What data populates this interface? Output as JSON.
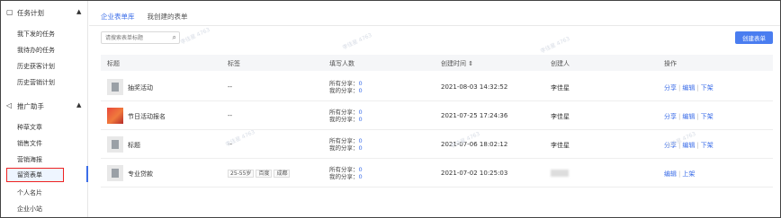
{
  "sidebar": {
    "groups": [
      {
        "label": "任务计划",
        "icon": "task-icon",
        "items": [
          "我下发的任务",
          "我待办的任务",
          "历史获客计划",
          "历史营销计划"
        ]
      },
      {
        "label": "推广助手",
        "icon": "megaphone-icon",
        "items": [
          "种草文章",
          "销售文件",
          "营销海报",
          "留资表单",
          "个人名片",
          "企业小站"
        ]
      }
    ]
  },
  "tabs": [
    "企业表单库",
    "我创建的表单"
  ],
  "search": {
    "placeholder": "请搜索表单标题"
  },
  "create_button": "创建表单",
  "table": {
    "headers": [
      "标题",
      "标签",
      "填写人数",
      "创建时间 ⇕",
      "创建人",
      "操作"
    ],
    "fill_labels": {
      "all": "所有分享：",
      "mine": "我的分享："
    },
    "rows": [
      {
        "title": "抽奖活动",
        "tag": "--",
        "all": "0",
        "mine": "0",
        "time": "2021-08-03 14:32:52",
        "creator": "李佳星",
        "ops": [
          "分享",
          "编辑",
          "下架"
        ],
        "thumb": "doc"
      },
      {
        "title": "节日活动报名",
        "tag": "--",
        "all": "0",
        "mine": "0",
        "time": "2021-07-25 17:24:36",
        "creator": "李佳星",
        "ops": [
          "分享",
          "编辑",
          "下架"
        ],
        "thumb": "img"
      },
      {
        "title": "标题",
        "tag": "--",
        "all": "0",
        "mine": "0",
        "time": "2021-07-06 18:02:12",
        "creator": "李佳星",
        "ops": [
          "分享",
          "编辑",
          "下架"
        ],
        "thumb": "doc"
      },
      {
        "title": "专业贷款",
        "tags": [
          "25-55岁",
          "百度",
          "成都"
        ],
        "all": "0",
        "mine": "0",
        "time": "2021-07-02 10:25:03",
        "creator": "",
        "ops": [
          "编辑",
          "上架"
        ],
        "thumb": "doc"
      }
    ]
  },
  "watermark": "李佳星 4763",
  "colors": {
    "accent": "#3b6de8",
    "button": "#4a7df0",
    "highlight_border": "#e22222"
  }
}
